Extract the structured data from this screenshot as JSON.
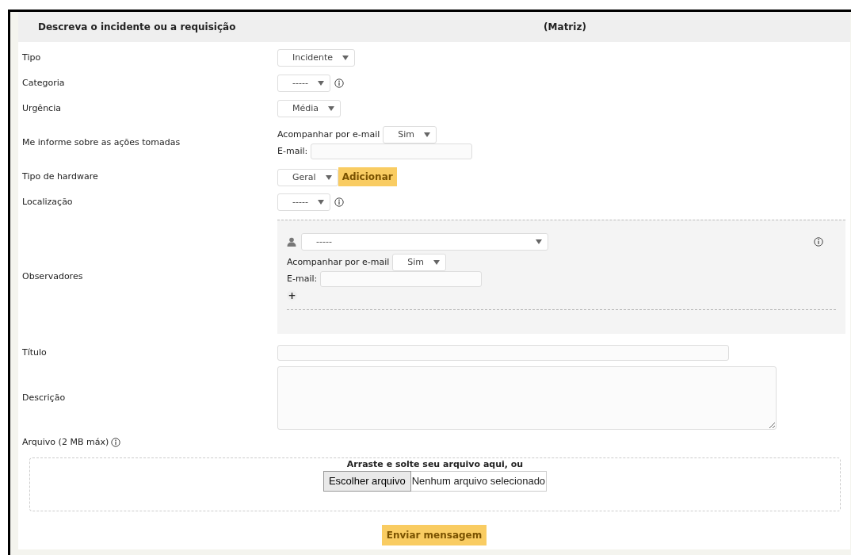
{
  "header": {
    "title": "Descreva o incidente ou a requisição",
    "column_2": "(Matriz)"
  },
  "fields": [
    {
      "kind": "select",
      "label": "Tipo",
      "value": "Incidente"
    },
    {
      "kind": "select",
      "label": "Categoria",
      "value": "-----",
      "info": true
    },
    {
      "kind": "select",
      "label": "Urgência",
      "value": "Média"
    },
    {
      "kind": "notify",
      "label": "Me informe sobre as ações tomadas",
      "follow_label": "Acompanhar por e-mail",
      "follow_value": "Sim",
      "email_label": "E-mail:"
    },
    {
      "kind": "select",
      "label": "Tipo de hardware",
      "value": "Geral",
      "button": "Adicionar"
    },
    {
      "kind": "select",
      "label": "Localização",
      "value": "-----",
      "info": true
    },
    {
      "kind": "observers",
      "label": "Observadores",
      "value": "-----",
      "follow_label": "Acompanhar por e-mail",
      "follow_value": "Sim",
      "email_label": "E-mail:",
      "add": "+"
    },
    {
      "kind": "text",
      "label": "Título"
    },
    {
      "kind": "textarea",
      "label": "Descrição"
    }
  ],
  "attachment": {
    "label": "Arquivo (2 MB máx)",
    "drop_text": "Arraste e solte seu arquivo aqui, ou",
    "choose_button": "Escolher arquivo",
    "no_file": "Nenhum arquivo selecionado"
  },
  "submit": "Enviar mensagem"
}
